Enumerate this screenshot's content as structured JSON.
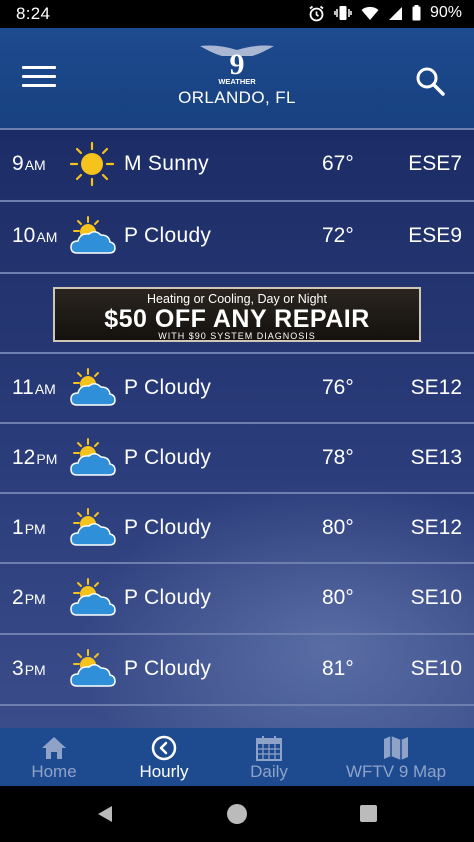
{
  "status": {
    "time": "8:24",
    "battery": "90%"
  },
  "header": {
    "logo_number": "9",
    "logo_text": "WEATHER",
    "location": "ORLANDO, FL"
  },
  "hours": [
    {
      "hour": "9",
      "period": "AM",
      "icon": "sun-icon",
      "condition": "M Sunny",
      "temp": "67°",
      "wind": "ESE7"
    },
    {
      "hour": "10",
      "period": "AM",
      "icon": "partly-cloudy-icon",
      "condition": "P Cloudy",
      "temp": "72°",
      "wind": "ESE9"
    },
    {
      "hour": "11",
      "period": "AM",
      "icon": "partly-cloudy-icon",
      "condition": "P Cloudy",
      "temp": "76°",
      "wind": "SE12"
    },
    {
      "hour": "12",
      "period": "PM",
      "icon": "partly-cloudy-icon",
      "condition": "P Cloudy",
      "temp": "78°",
      "wind": "SE13"
    },
    {
      "hour": "1",
      "period": "PM",
      "icon": "partly-cloudy-icon",
      "condition": "P Cloudy",
      "temp": "80°",
      "wind": "SE12"
    },
    {
      "hour": "2",
      "period": "PM",
      "icon": "partly-cloudy-icon",
      "condition": "P Cloudy",
      "temp": "80°",
      "wind": "SE10"
    },
    {
      "hour": "3",
      "period": "PM",
      "icon": "partly-cloudy-icon",
      "condition": "P Cloudy",
      "temp": "81°",
      "wind": "SE10"
    }
  ],
  "ad": {
    "line1": "Heating or Cooling, Day or Night",
    "line2": "$50 OFF ANY REPAIR",
    "line3": "WITH $90 SYSTEM DIAGNOSIS"
  },
  "tabs": [
    {
      "label": "Home",
      "icon": "home-icon",
      "active": false
    },
    {
      "label": "Hourly",
      "icon": "clock-icon",
      "active": true
    },
    {
      "label": "Daily",
      "icon": "calendar-icon",
      "active": false
    },
    {
      "label": "WFTV 9 Map",
      "icon": "map-icon",
      "active": false
    }
  ],
  "colors": {
    "header": "#1e4a8f",
    "active_tab": "#ffffff",
    "inactive_tab": "#8fa3c8",
    "sun": "#f6c21c",
    "cloud": "#2f8fd8"
  }
}
